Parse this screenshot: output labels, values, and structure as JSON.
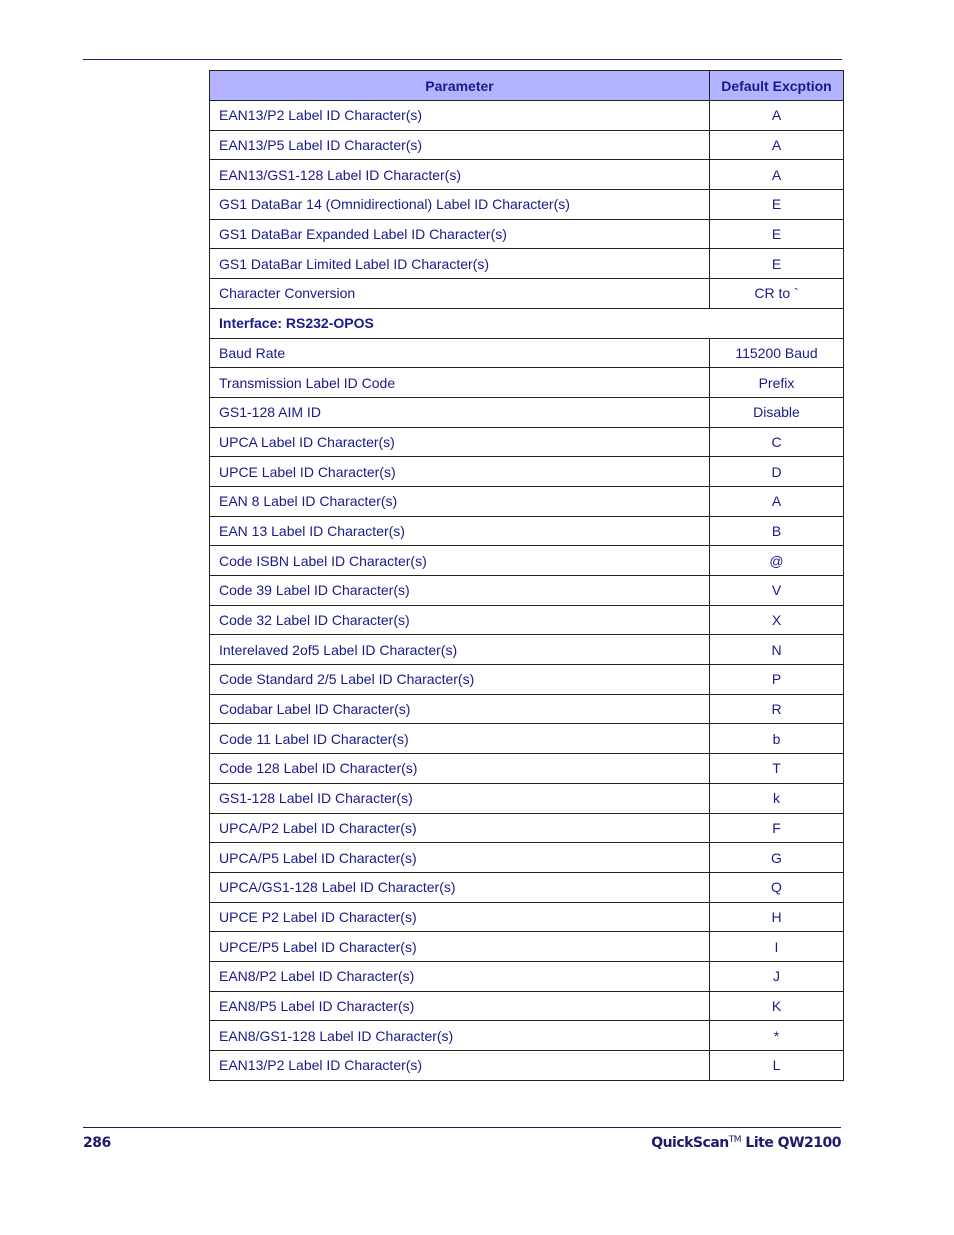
{
  "table": {
    "headers": [
      "Parameter",
      "Default Excption"
    ],
    "rows": [
      {
        "param": "EAN13/P2 Label ID Character(s)",
        "value": "A"
      },
      {
        "param": "EAN13/P5 Label ID Character(s)",
        "value": "A"
      },
      {
        "param": "EAN13/GS1-128 Label ID Character(s)",
        "value": "A"
      },
      {
        "param": "GS1 DataBar 14 (Omnidirectional) Label ID Character(s)",
        "value": "E"
      },
      {
        "param": "GS1 DataBar Expanded Label ID Character(s)",
        "value": "E"
      },
      {
        "param": "GS1 DataBar Limited Label ID Character(s)",
        "value": "E"
      },
      {
        "param": "Character Conversion",
        "value": "CR to `"
      },
      {
        "section": "Interface: RS232-OPOS"
      },
      {
        "param": "Baud Rate",
        "value": "115200 Baud"
      },
      {
        "param": "Transmission Label ID Code",
        "value": "Prefix"
      },
      {
        "param": "GS1-128 AIM ID",
        "value": "Disable"
      },
      {
        "param": "UPCA Label ID Character(s)",
        "value": "C"
      },
      {
        "param": "UPCE Label ID Character(s)",
        "value": "D"
      },
      {
        "param": "EAN 8 Label ID Character(s)",
        "value": "A"
      },
      {
        "param": "EAN 13 Label ID Character(s)",
        "value": "B"
      },
      {
        "param": "Code ISBN Label ID Character(s)",
        "value": "@"
      },
      {
        "param": "Code 39 Label ID Character(s)",
        "value": "V"
      },
      {
        "param": "Code 32 Label ID Character(s)",
        "value": "X"
      },
      {
        "param": "Interelaved 2of5 Label ID Character(s)",
        "value": "N"
      },
      {
        "param": "Code Standard 2/5 Label ID Character(s)",
        "value": "P"
      },
      {
        "param": "Codabar Label ID Character(s)",
        "value": "R"
      },
      {
        "param": "Code 11 Label ID Character(s)",
        "value": "b"
      },
      {
        "param": "Code 128 Label ID Character(s)",
        "value": "T"
      },
      {
        "param": "GS1-128 Label ID Character(s)",
        "value": "k"
      },
      {
        "param": "UPCA/P2 Label ID Character(s)",
        "value": "F"
      },
      {
        "param": "UPCA/P5 Label ID Character(s)",
        "value": "G"
      },
      {
        "param": "UPCA/GS1-128 Label ID Character(s)",
        "value": "Q"
      },
      {
        "param": "UPCE P2 Label ID Character(s)",
        "value": "H"
      },
      {
        "param": "UPCE/P5 Label ID Character(s)",
        "value": "I"
      },
      {
        "param": "EAN8/P2 Label ID Character(s)",
        "value": "J"
      },
      {
        "param": "EAN8/P5 Label ID Character(s)",
        "value": "K"
      },
      {
        "param": "EAN8/GS1-128 Label ID Character(s)",
        "value": "*"
      },
      {
        "param": "EAN13/P2 Label ID Character(s)",
        "value": "L"
      }
    ]
  },
  "footer": {
    "page_number": "286",
    "title_main": "QuickScan",
    "title_tm": "TM",
    "title_rest": " Lite QW2100"
  },
  "colors": {
    "header_bg": "#b3b3ff",
    "text": "#1a1a8c"
  }
}
